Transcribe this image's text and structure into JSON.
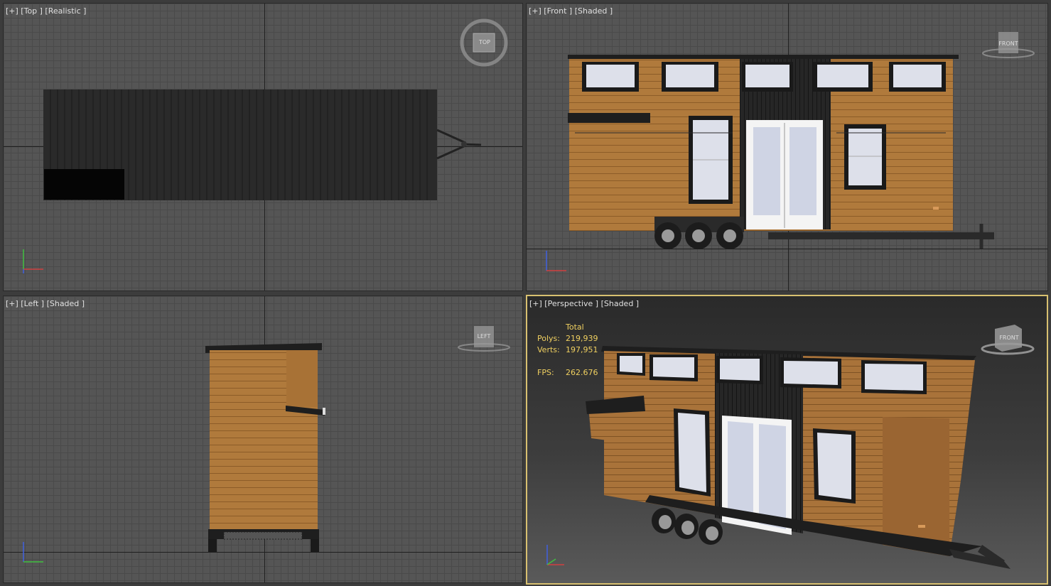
{
  "viewports": {
    "top": {
      "label": "[+] [Top ] [Realistic ]",
      "cube": "TOP"
    },
    "front": {
      "label": "[+] [Front ] [Shaded ]",
      "cube": "FRONT"
    },
    "left": {
      "label": "[+] [Left ] [Shaded ]",
      "cube": "LEFT"
    },
    "perspective": {
      "label": "[+] [Perspective ] [Shaded ]",
      "cube": "FRONT"
    }
  },
  "stats": {
    "header": "Total",
    "polys_label": "Polys:",
    "polys_value": "219,939",
    "verts_label": "Verts:",
    "verts_value": "197,951",
    "fps_label": "FPS:",
    "fps_value": "262.676"
  },
  "colors": {
    "grid_bg": "#555555",
    "wood": "#b07a3c",
    "dark_cladding": "#222222",
    "window_glass": "#dde0ea",
    "stats_text": "#f0d060",
    "active_border": "#d8c070"
  }
}
